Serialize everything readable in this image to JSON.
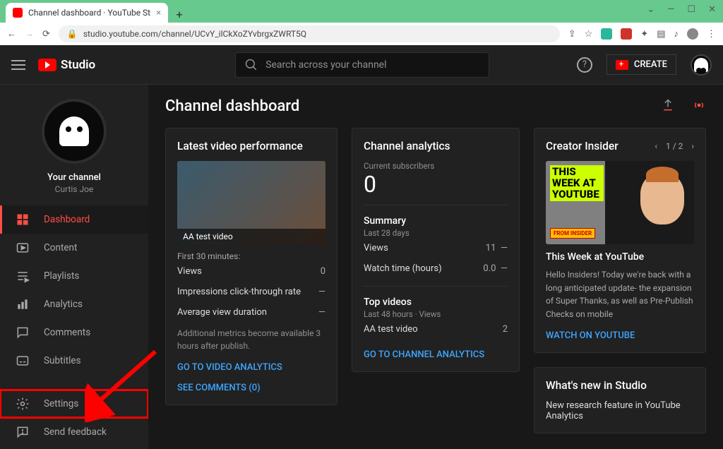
{
  "browser": {
    "tab_title": "Channel dashboard · YouTube St",
    "url": "studio.youtube.com/channel/UCvY_ilCkXoZYvbrgxZWRT5Q"
  },
  "topbar": {
    "brand": "Studio",
    "search_placeholder": "Search across your channel",
    "create_label": "CREATE"
  },
  "channel": {
    "your_channel": "Your channel",
    "name": "Curtis Joe"
  },
  "nav": {
    "dashboard": "Dashboard",
    "content": "Content",
    "playlists": "Playlists",
    "analytics": "Analytics",
    "comments": "Comments",
    "subtitles": "Subtitles",
    "settings": "Settings",
    "feedback": "Send feedback"
  },
  "page": {
    "title": "Channel dashboard"
  },
  "latest": {
    "heading": "Latest video performance",
    "video_title": "AA test video",
    "first30": "First 30 minutes:",
    "views_label": "Views",
    "views_value": "0",
    "ctr_label": "Impressions click-through rate",
    "ctr_value": "—",
    "avd_label": "Average view duration",
    "avd_value": "—",
    "note": "Additional metrics become available 3 hours after publish.",
    "analytics_link": "GO TO VIDEO ANALYTICS",
    "comments_link": "SEE COMMENTS (0)"
  },
  "analytics": {
    "heading": "Channel analytics",
    "subs_label": "Current subscribers",
    "subs_value": "0",
    "summary": "Summary",
    "summary_sub": "Last 28 days",
    "views_label": "Views",
    "views_value": "11",
    "views_delta": "—",
    "watch_label": "Watch time (hours)",
    "watch_value": "0.0",
    "watch_delta": "—",
    "top": "Top videos",
    "top_sub": "Last 48 hours · Views",
    "top_video": "AA test video",
    "top_video_val": "2",
    "link": "GO TO CHANNEL ANALYTICS"
  },
  "insider": {
    "heading": "Creator Insider",
    "pager": "1 / 2",
    "thumb_text": "THIS WEEK AT YOUTUBE",
    "badge": "FROM INSIDER",
    "title": "This Week at YouTube",
    "desc": "Hello Insiders! Today we're back with a long anticipated update- the expansion of Super Thanks, as well as Pre-Publish Checks on mobile",
    "link": "WATCH ON YOUTUBE"
  },
  "whatsnew": {
    "heading": "What's new in Studio",
    "item": "New research feature in YouTube Analytics"
  }
}
